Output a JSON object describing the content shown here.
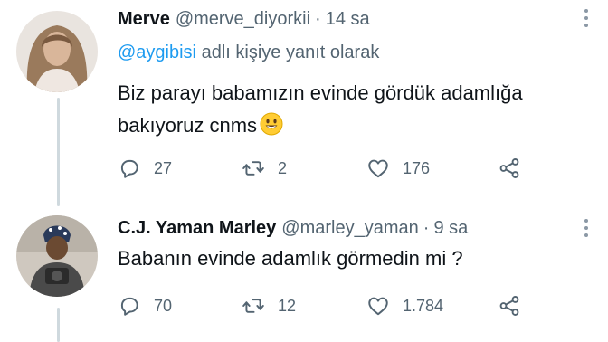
{
  "tweets": [
    {
      "author_name": "Merve",
      "handle": "@merve_diyorkii",
      "dot": "·",
      "time": "14 sa",
      "reply_mention": "@aygibisi",
      "reply_suffix": "adlı kişiye yanıt olarak",
      "text": "Biz parayı babamızın evinde gördük adamlığa bakıyoruz cnms",
      "emoji": "smiling-face-icon",
      "replies": "27",
      "retweets": "2",
      "likes": "176"
    },
    {
      "author_name": "C.J. Yaman Marley",
      "handle": "@marley_yaman",
      "dot": "·",
      "time": "9 sa",
      "text": "Babanın evinde adamlık görmedin mi ?",
      "replies": "70",
      "retweets": "12",
      "likes": "1.784"
    }
  ],
  "colors": {
    "mention": "#1d9bf0",
    "secondary_text": "#536471",
    "thread_line": "#cfd9de"
  }
}
